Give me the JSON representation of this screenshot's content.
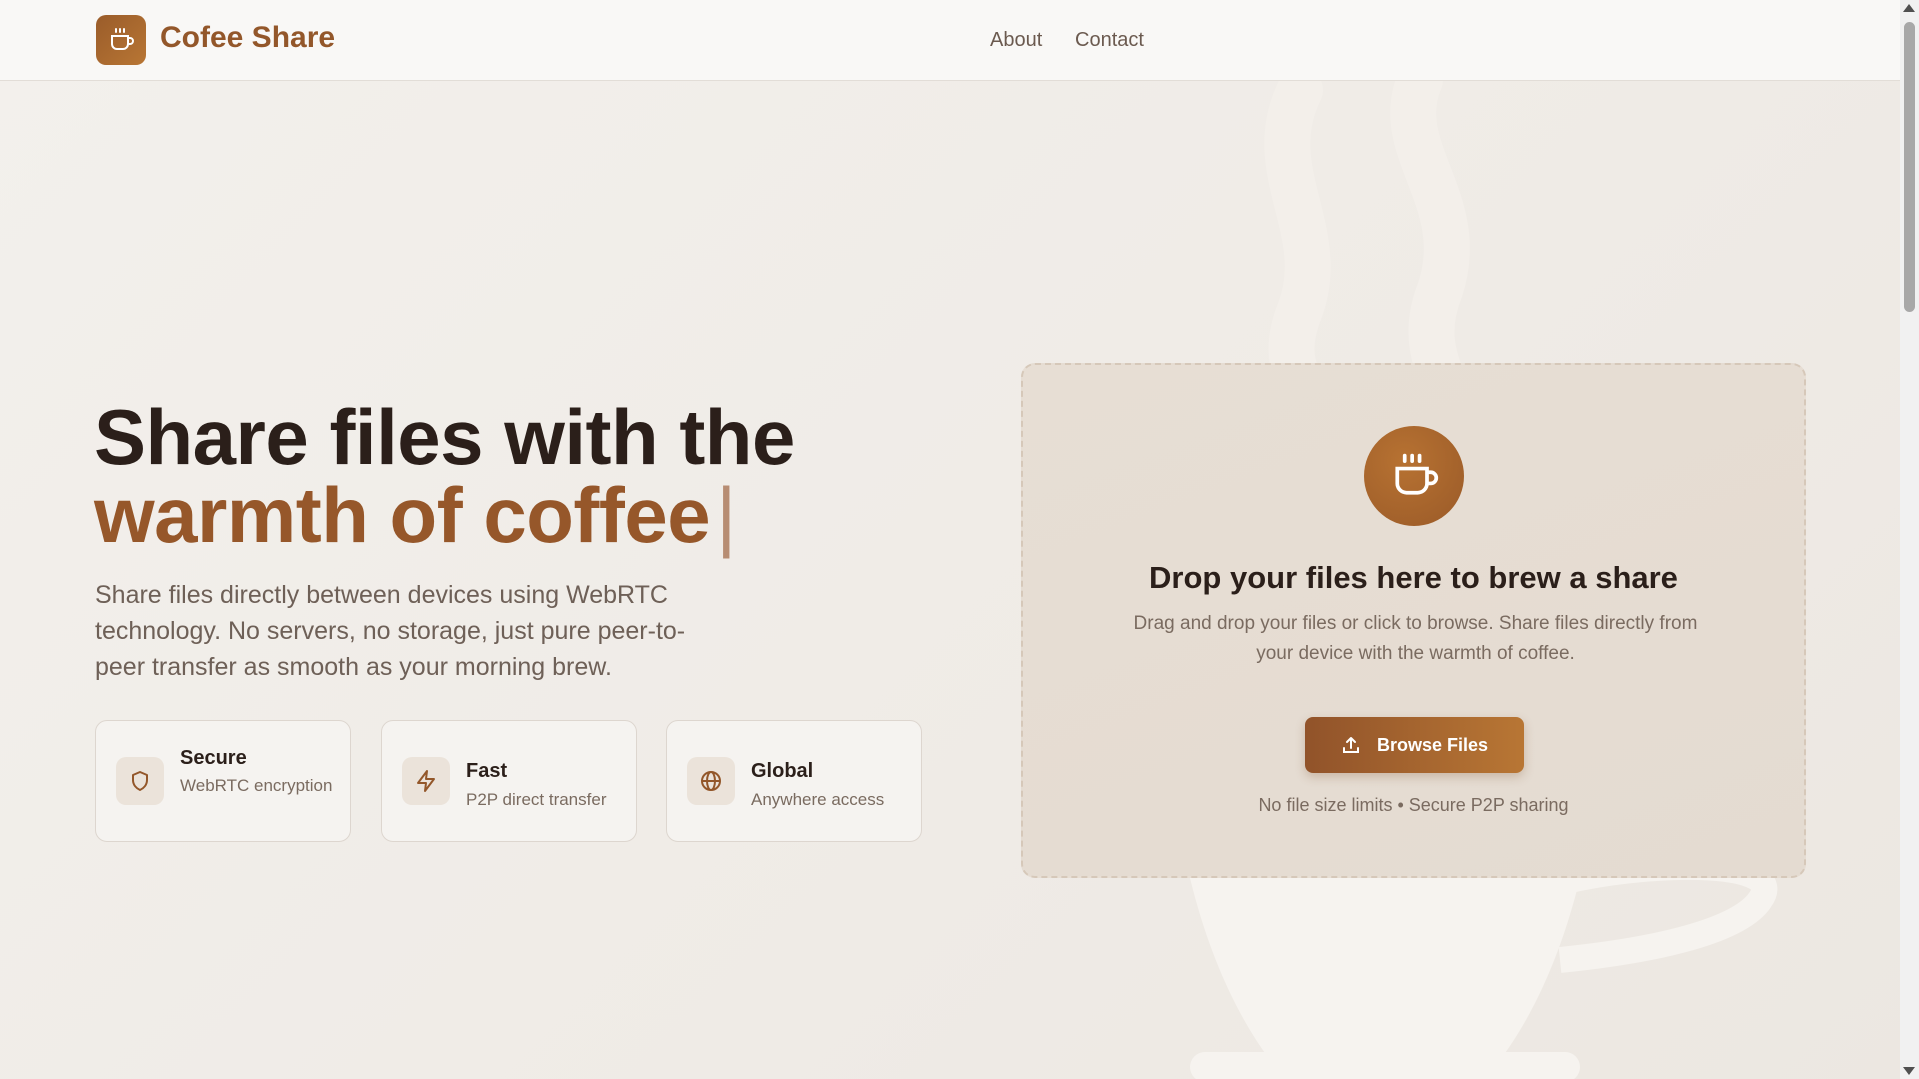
{
  "header": {
    "brand": "Cofee Share",
    "nav": [
      {
        "label": "About"
      },
      {
        "label": "Contact"
      }
    ]
  },
  "hero": {
    "title_line1": "Share files with the",
    "title_line2": "warmth of coffee",
    "caret": "|",
    "description": "Share files directly between devices using WebRTC technology. No servers, no storage, just pure peer-to-peer transfer as smooth as your morning brew."
  },
  "features": [
    {
      "title": "Secure",
      "subtitle": "WebRTC encryption",
      "icon": "shield-icon"
    },
    {
      "title": "Fast",
      "subtitle": "P2P direct transfer",
      "icon": "lightning-icon"
    },
    {
      "title": "Global",
      "subtitle": "Anywhere access",
      "icon": "globe-icon"
    }
  ],
  "dropzone": {
    "title": "Drop your files here to brew a share",
    "description": "Drag and drop your files or click to browse. Share files directly from your device with the warmth of coffee.",
    "button_label": "Browse Files",
    "note": "No file size limits • Secure P2P sharing",
    "icon": "coffee-cup-icon"
  },
  "colors": {
    "accent": "#96572a",
    "accent_light": "#b87634",
    "text_dark": "#2b1f1a",
    "text_muted": "#7a6b60"
  }
}
